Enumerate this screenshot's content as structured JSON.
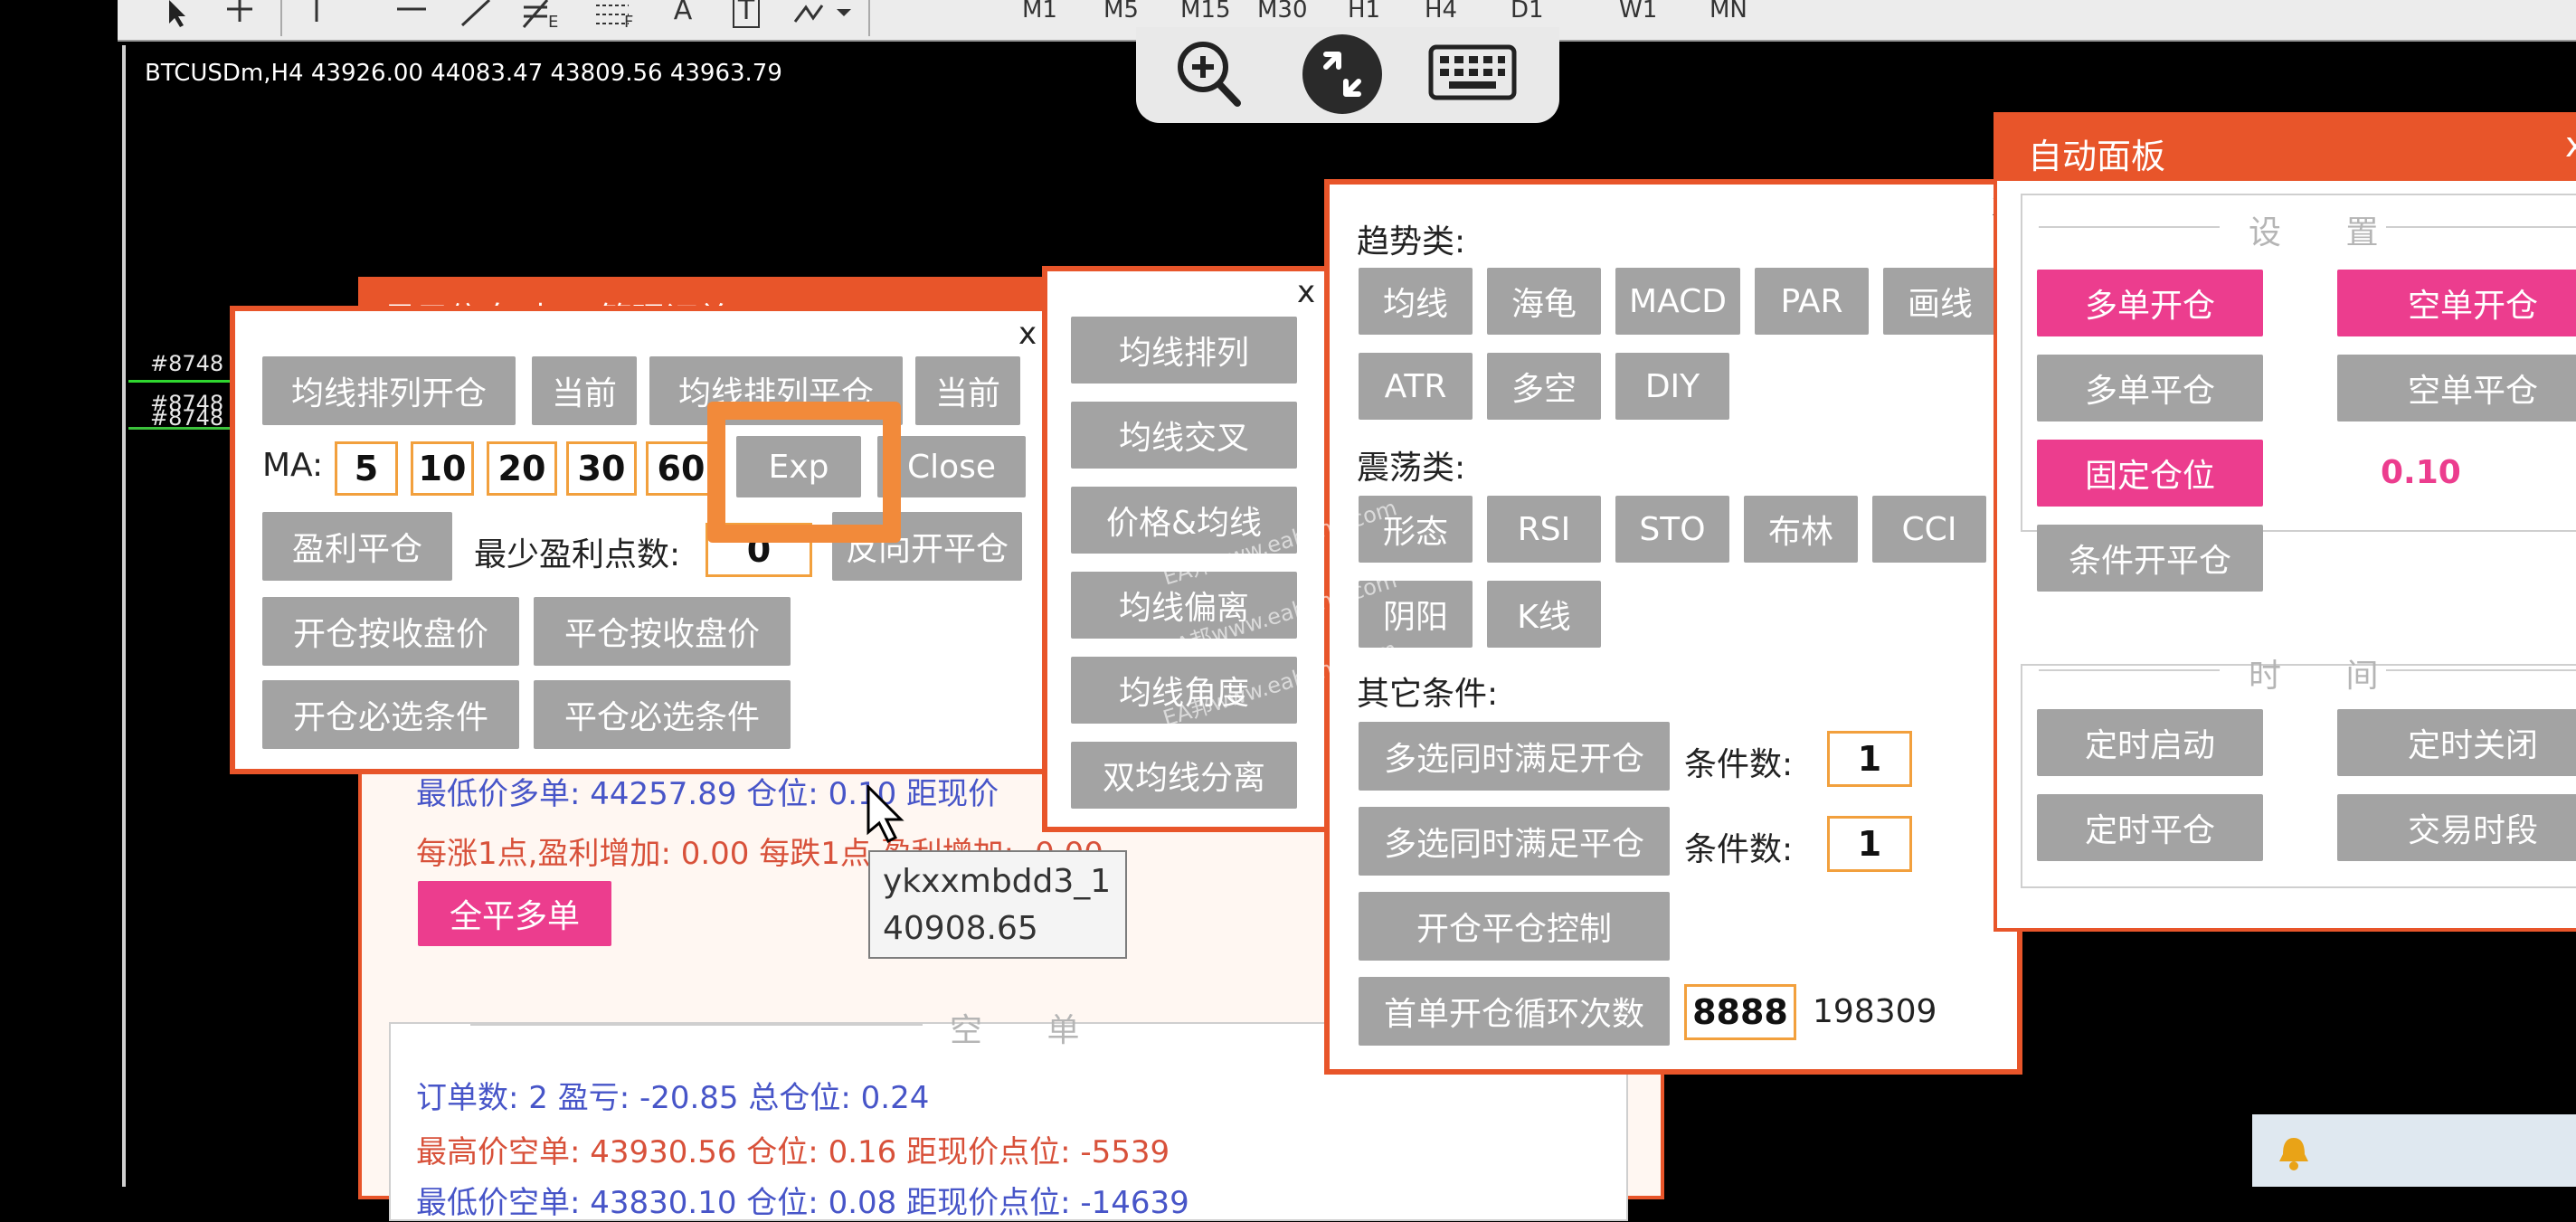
{
  "toolbar": {
    "timeframes": [
      "M1",
      "M5",
      "M15",
      "M30",
      "H1",
      "H4",
      "D1",
      "W1",
      "MN"
    ],
    "tools": [
      "cursor-icon",
      "crosshair-icon",
      "vertical-line-icon",
      "horizontal-line-icon",
      "trendline-icon",
      "fibonacci-icon",
      "channel-icon",
      "text-icon",
      "label-icon",
      "arrow-icon"
    ],
    "tool_letters": {
      "fib": "E",
      "channel": "F",
      "text": "A",
      "label": "T"
    }
  },
  "chart": {
    "header": "BTCUSDm,H4  43926.00 44083.47 43809.56 43963.79",
    "order_labels": [
      "#8748",
      "#8748",
      "#8748"
    ]
  },
  "remote": {
    "icons": [
      "zoom-in-icon",
      "remote-session-icon",
      "keyboard-icon"
    ]
  },
  "info_panel": {
    "title": "显示信息 本EA管理订单",
    "long": {
      "low_price": "最低价多单: 44257.89  仓位: 0.10  距现价",
      "profit_line": "每涨1点,盈利增加: 0.00    每跌1点,盈利增加: -0.00",
      "close_all": "全平多单"
    },
    "short": {
      "section": "空  单",
      "summary": "订单数: 2  盈亏: -20.85  总仓位: 0.24",
      "high_price": "最高价空单: 43930.56  仓位: 0.16  距现价点位: -5539",
      "low_price": "最低价空单: 43830.10  仓位: 0.08  距现价点位: -14639"
    }
  },
  "ma_panel": {
    "close": "x",
    "btn_open": "均线排列开仓",
    "btn_current1": "当前",
    "btn_close": "均线排列平仓",
    "btn_current2": "当前",
    "ma_label": "MA:",
    "ma_values": [
      "5",
      "10",
      "20",
      "30",
      "60"
    ],
    "exp": "Exp",
    "close_btn": "Close",
    "profit_close": "盈利平仓",
    "min_points_label": "最少盈利点数:",
    "min_points_value": "0",
    "reverse": "反向开平仓",
    "open_by_close": "开仓按收盘价",
    "close_by_close": "平仓按收盘价",
    "open_required": "开仓必选条件",
    "close_required": "平仓必选条件"
  },
  "tooltip": {
    "line1": "ykxxmbdd3_1",
    "line2": "40908.65"
  },
  "ma_list_panel": {
    "close": "x",
    "items": [
      "均线排列",
      "均线交叉",
      "价格&均线",
      "均线偏离",
      "均线角度",
      "双均线分离"
    ]
  },
  "indicator_panel": {
    "close": "x",
    "trend_title": "趋势类:",
    "trend_row1": [
      "均线",
      "海龟",
      "MACD",
      "PAR",
      "画线"
    ],
    "trend_row2": [
      "ATR",
      "多空",
      "DIY"
    ],
    "osc_title": "震荡类:",
    "osc_row1": [
      "形态",
      "RSI",
      "STO",
      "布林",
      "CCI"
    ],
    "osc_row2": [
      "阴阳",
      "K线"
    ],
    "other_title": "其它条件:",
    "multi_open": "多选同时满足开仓",
    "multi_close": "多选同时满足平仓",
    "cond_count_label": "条件数:",
    "cond_open_value": "1",
    "cond_close_value": "1",
    "open_close_ctrl": "开仓平仓控制",
    "first_loop": "首单开仓循环次数",
    "first_loop_value": "8888",
    "first_loop_extra": "198309"
  },
  "auto_panel": {
    "title": "自动面板",
    "close": "x",
    "settings_section": "设 置",
    "long_open": "多单开仓",
    "short_open": "空单开仓",
    "long_close": "多单平仓",
    "short_close": "空单平仓",
    "fixed_lot": "固定仓位",
    "lot_value": "0.10",
    "cond_open_close": "条件开平仓",
    "time_section": "时 间",
    "timer_start": "定时启动",
    "timer_stop": "定时关闭",
    "timer_close": "定时平仓",
    "trade_session": "交易时段"
  },
  "watermark": "EA邦www.eabang.com",
  "colors": {
    "accent": "#e8552a",
    "pink": "#ec3d8e",
    "button_gray": "#a3a3a3",
    "highlight": "#f28a3a",
    "lot_text": "#ec3d8e"
  }
}
